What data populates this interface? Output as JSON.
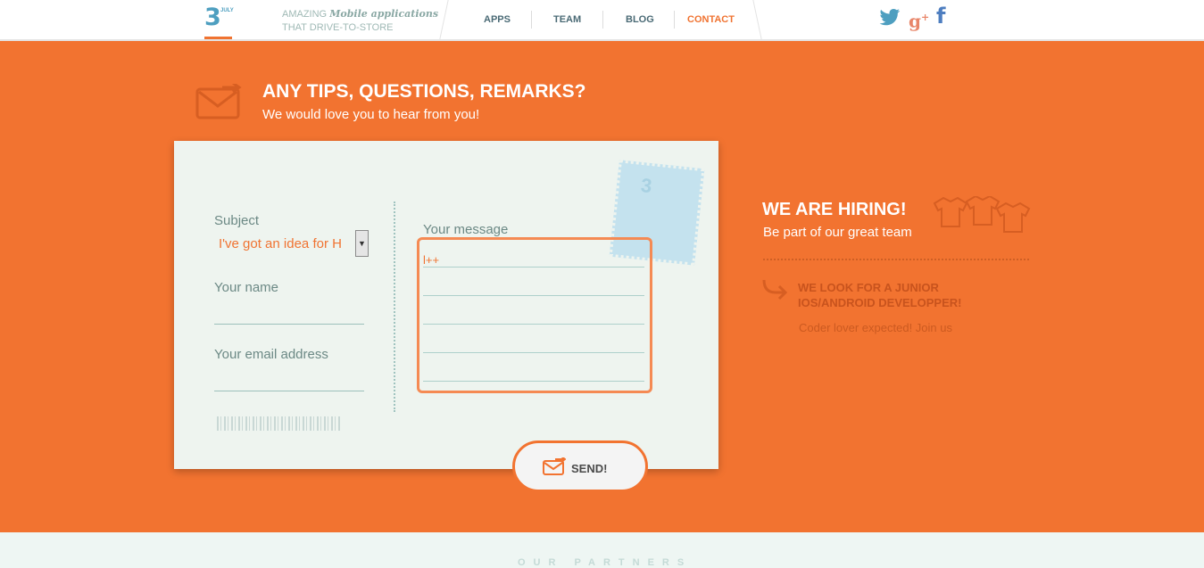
{
  "header": {
    "logo_number": "3",
    "logo_month": "JULY",
    "tagline_prefix": "AMAZING",
    "tagline_emphasis": "Mobile applications",
    "tagline_line2": "THAT DRIVE-TO-STORE",
    "nav": [
      "APPS",
      "TEAM",
      "BLOG",
      "CONTACT"
    ],
    "active_nav": "CONTACT",
    "social": [
      "twitter-icon",
      "google-plus-icon",
      "facebook-icon"
    ]
  },
  "contact": {
    "title": "ANY TIPS, QUESTIONS, REMARKS?",
    "subtitle": "We would love you to hear from you!",
    "subject_label": "Subject",
    "subject_value": "I've got an idea for H",
    "name_label": "Your name",
    "email_label": "Your email address",
    "message_label": "Your message",
    "message_value": "l++",
    "send_label": "SEND!"
  },
  "hiring": {
    "title": "WE ARE HIRING!",
    "subtitle": "Be part of our great team",
    "job_title_line1": "WE LOOK FOR A JUNIOR",
    "job_title_line2": "IOS/ANDROID DEVELOPPER!",
    "job_desc": "Coder lover expected! Join us"
  },
  "footer": {
    "partners_title": "OUR PARTNERS"
  },
  "colors": {
    "accent": "#f27330",
    "logo_blue": "#4e9fc0",
    "card_bg": "#eef4ef"
  }
}
